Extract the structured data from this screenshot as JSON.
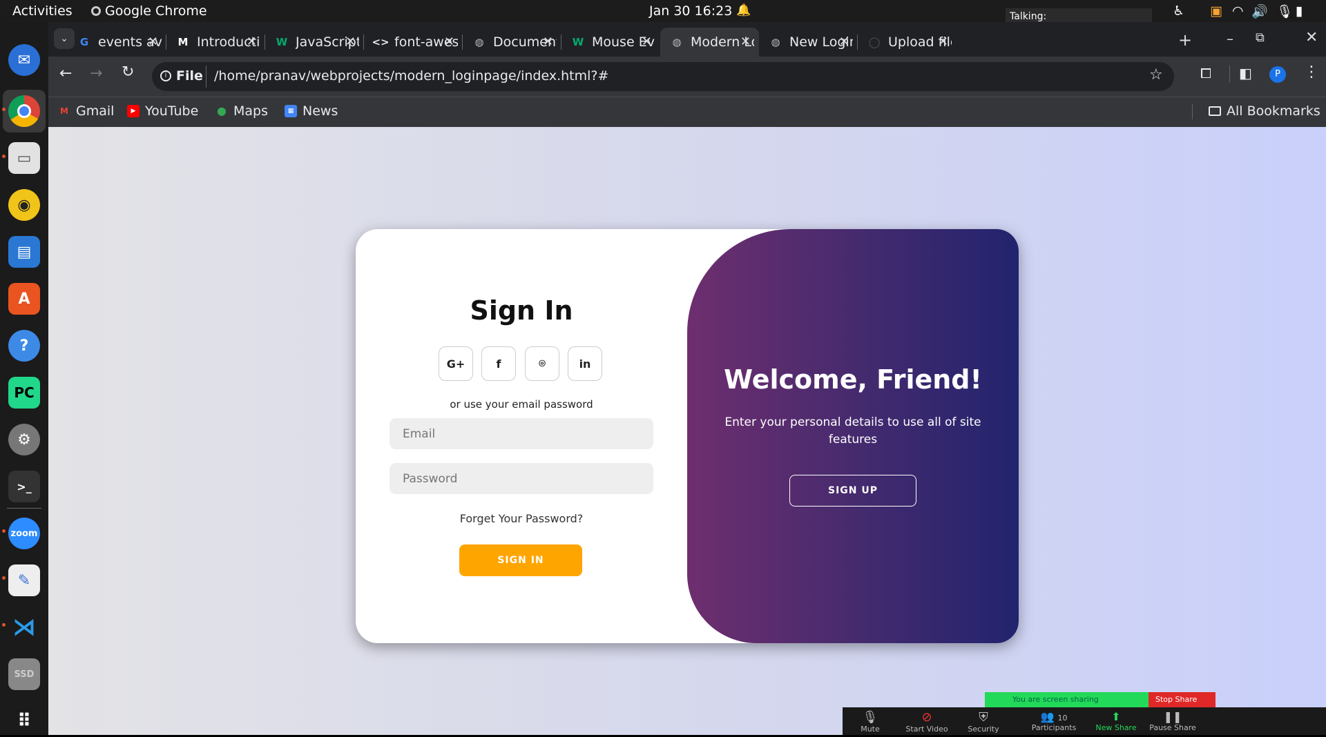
{
  "topbar": {
    "activities": "Activities",
    "app": "Google Chrome",
    "datetime": "Jan 30  16:23",
    "talking": "Talking:"
  },
  "tabs": [
    {
      "label": "events available",
      "icon": "google-icon"
    },
    {
      "label": "Introduction",
      "icon": "medium-icon"
    },
    {
      "label": "JavaScript",
      "icon": "w3schools-icon"
    },
    {
      "label": "font-awesome",
      "icon": "code-icon"
    },
    {
      "label": "Document",
      "icon": "globe-icon"
    },
    {
      "label": "Mouse Events",
      "icon": "w3schools-icon"
    },
    {
      "label": "Modern Login",
      "icon": "globe-icon",
      "active": true
    },
    {
      "label": "New Login",
      "icon": "globe-icon"
    },
    {
      "label": "Upload files",
      "icon": "github-icon"
    }
  ],
  "omnibox": {
    "scheme": "File",
    "url": "/home/pranav/webprojects/modern_loginpage/index.html?#"
  },
  "bookmarks": [
    {
      "label": "Gmail"
    },
    {
      "label": "YouTube"
    },
    {
      "label": "Maps"
    },
    {
      "label": "News"
    }
  ],
  "all_bookmarks": "All Bookmarks",
  "profile_initial": "P",
  "signin": {
    "title": "Sign In",
    "social": [
      "G+",
      "f",
      "⌾",
      "in"
    ],
    "alt_text": "or use your email password",
    "email_placeholder": "Email",
    "password_placeholder": "Password",
    "forgot": "Forget Your Password?",
    "button": "SIGN IN"
  },
  "panel": {
    "title": "Welcome, Friend!",
    "text": "Enter your personal details to use all of site features",
    "button": "SIGN UP"
  },
  "zoom": {
    "sharing": "You are screen sharing",
    "stop": "Stop Share",
    "participants_count": "10",
    "items": [
      "Mute",
      "Start Video",
      "Security",
      "Participants",
      "New Share",
      "Pause Share"
    ]
  },
  "colors": {
    "accent": "#ffa500",
    "panel_start": "#6e2e6e",
    "panel_end": "#22246e"
  }
}
